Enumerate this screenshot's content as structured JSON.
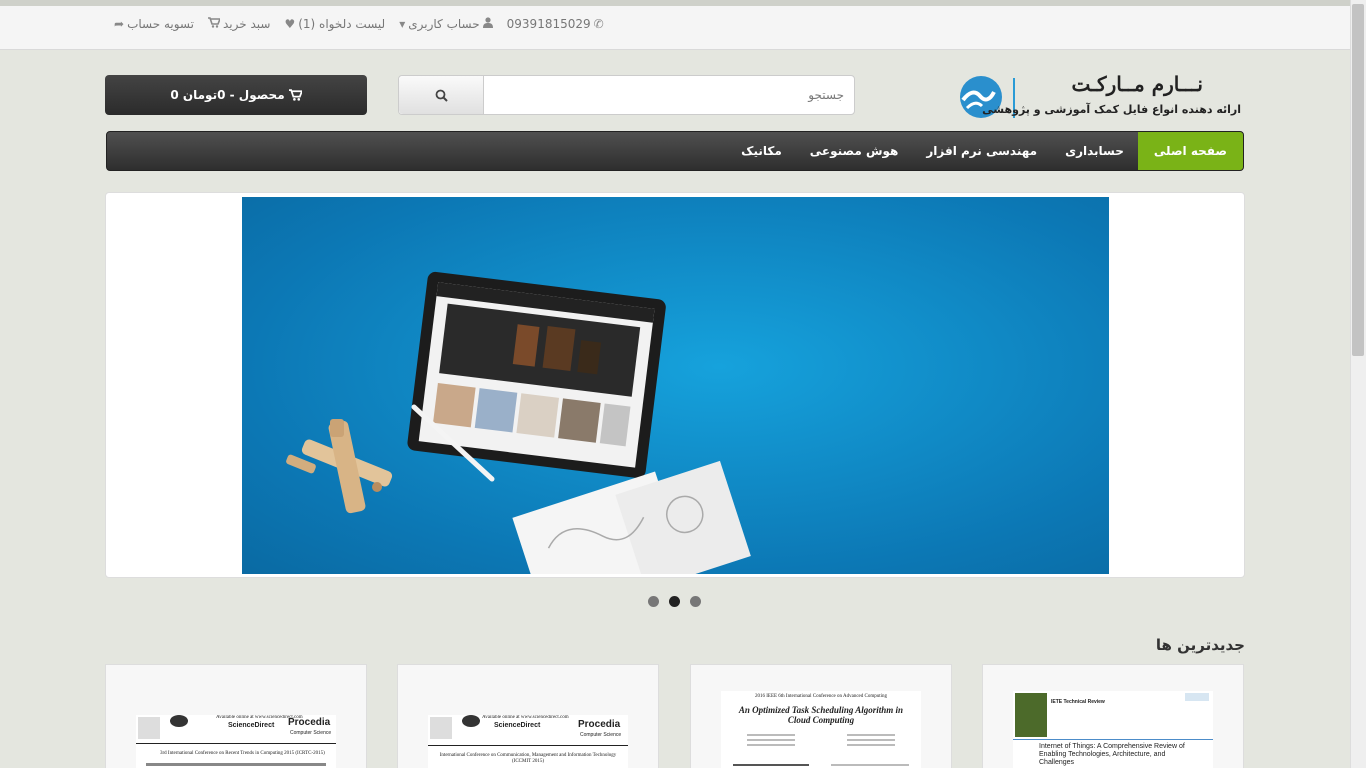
{
  "topbar": {
    "links": [
      {
        "name": "checkout",
        "icon": "share-icon",
        "label": "تسویه حساب"
      },
      {
        "name": "cart",
        "icon": "cart-icon",
        "label": "سبد خرید"
      },
      {
        "name": "wishlist",
        "icon": "heart-icon",
        "label": "لیست دلخواه (1)"
      },
      {
        "name": "account",
        "icon": "user-icon",
        "label": "حساب کاربری"
      },
      {
        "name": "phone",
        "icon": "phone-icon",
        "label": "09391815029"
      }
    ]
  },
  "logo": {
    "title": "نـــارم مــارکـت",
    "subtitle": "ارائه دهنده انواع فایل کمک آموزشی و پژوهشی"
  },
  "search": {
    "placeholder": "جستجو"
  },
  "cart": {
    "label": "0 محصول - 0تومان"
  },
  "nav": {
    "items": [
      "صفحه اصلی",
      "حسابداری",
      "مهندسی نرم افزار",
      "هوش مصنوعی",
      "مکانیک"
    ],
    "active_index": 0
  },
  "slider": {
    "dot_count": 3,
    "active_dot": 1
  },
  "section": {
    "latest_title": "جدیدترین ها"
  },
  "products": [
    {
      "name": "elsevier-procedia-icrtc",
      "header_small": "Available online at www.sciencedirect.com",
      "brand": "ScienceDirect",
      "journal": "Procedia",
      "journal_sub": "Computer Science",
      "conf": "3rd International Conference on Recent Trends in Computing 2015 (ICRTC-2015)"
    },
    {
      "name": "elsevier-procedia-iccmit",
      "header_small": "Available online at www.sciencedirect.com",
      "brand": "ScienceDirect",
      "journal": "Procedia",
      "journal_sub": "Computer Science",
      "conf": "International Conference on Communication, Management and Information Technology (ICCMIT 2015)"
    },
    {
      "name": "task-scheduling-paper",
      "header_small": "2016 IEEE 6th International Conference on Advanced Computing",
      "title": "An Optimized Task Scheduling Algorithm in Cloud Computing"
    },
    {
      "name": "iete-iot-paper",
      "journal": "IETE Technical Review",
      "title": "Internet of Things: A Comprehensive Review of Enabling Technologies, Architecture, and Challenges"
    }
  ],
  "colors": {
    "accent_green": "#7ab317",
    "logo_blue": "#2a9bd6",
    "slider_blue": "#0c78b5"
  }
}
